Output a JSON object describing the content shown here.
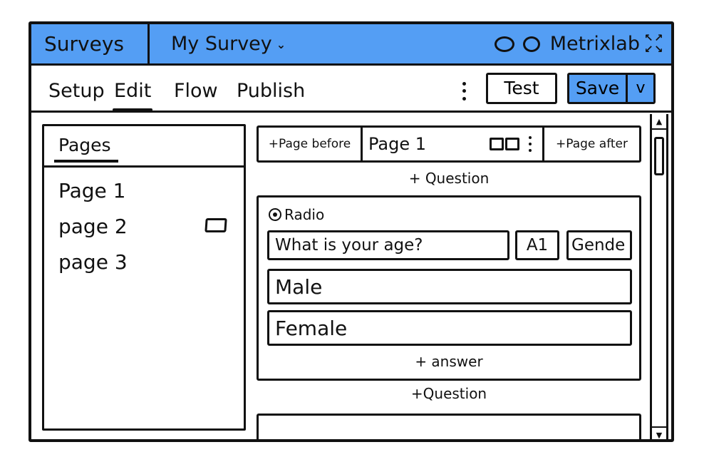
{
  "header": {
    "app_title": "Surveys",
    "survey_title": "My Survey",
    "survey_dropdown_icon": "chevron-down-icon",
    "brand": "Metrixlab",
    "status_icons": [
      "circle-icon",
      "circle-icon"
    ],
    "expand_icon": "expand-icon",
    "colors": {
      "accent": "#549ef4",
      "border": "#111111"
    }
  },
  "tabs": [
    {
      "label": "Setup",
      "active": false
    },
    {
      "label": "Edit",
      "active": true
    },
    {
      "label": "Flow",
      "active": false
    },
    {
      "label": "Publish",
      "active": false
    }
  ],
  "toolbar": {
    "more_icon": "kebab-icon",
    "test_label": "Test",
    "save_label": "Save",
    "save_dropdown_label": "v"
  },
  "pages_panel": {
    "title": "Pages",
    "items": [
      {
        "label": "Page 1"
      },
      {
        "label": "page 2",
        "has_icon": true
      },
      {
        "label": "page 3"
      }
    ]
  },
  "page_nav": {
    "page_before_label": "+Page before",
    "current_page": "Page 1",
    "page_after_label": "+Page after"
  },
  "editor": {
    "add_question_label": "+ Question",
    "question": {
      "type_label": "Radio",
      "text": "What is your age?",
      "code": "A1",
      "variable": "Gende",
      "answers": [
        "Male",
        "Female"
      ],
      "add_answer_label": "+ answer"
    },
    "add_question_label_2": "+Question"
  },
  "scrollbar": {
    "up_icon": "▲",
    "down_icon": "▼"
  }
}
